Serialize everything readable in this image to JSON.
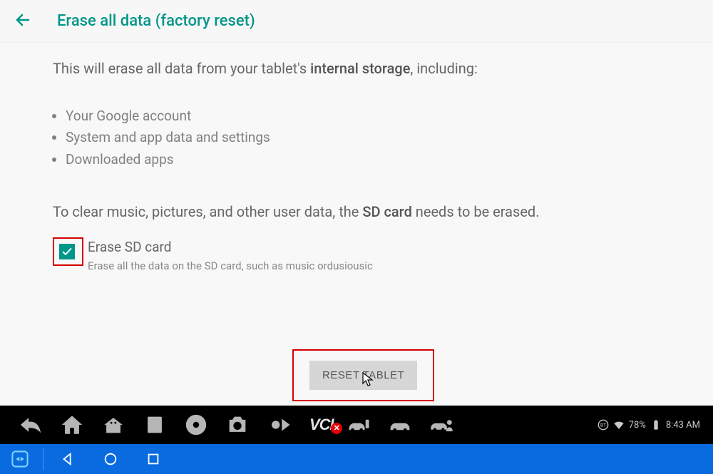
{
  "header": {
    "title": "Erase all data (factory reset)"
  },
  "intro": {
    "prefix": "This will erase all data from your tablet's ",
    "bold": "internal storage",
    "suffix": ", including:"
  },
  "bullets": [
    "Your Google account",
    "System and app data and settings",
    "Downloaded apps"
  ],
  "sdtext": {
    "prefix": "To clear music, pictures, and other user data, the ",
    "bold": "SD card",
    "suffix": " needs to be erased."
  },
  "sdoption": {
    "label": "Erase SD card",
    "desc": "Erase all the data on the SD card, such as music ordusiousic"
  },
  "button": {
    "label": "RESET TABLET"
  },
  "status": {
    "battery": "78%",
    "time": "8:43 AM"
  },
  "vci": "VCI"
}
